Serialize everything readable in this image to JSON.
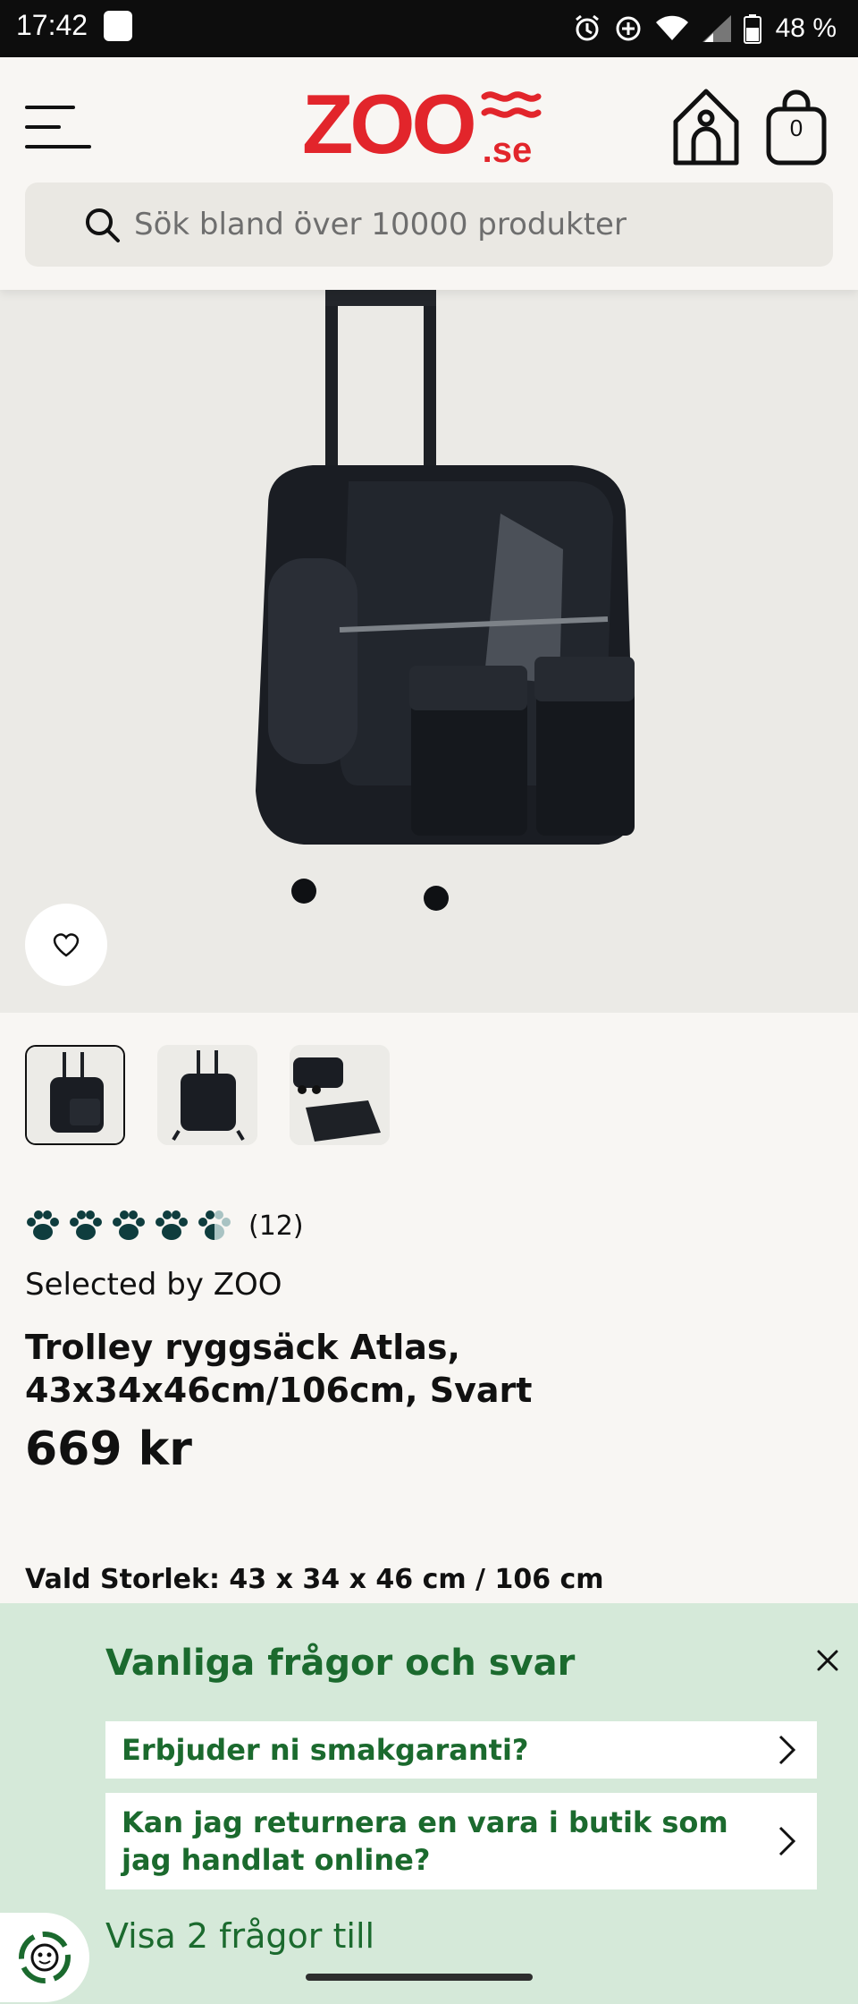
{
  "status_bar": {
    "time": "17:42",
    "battery_percent": "48 %"
  },
  "header": {
    "logo_text": "ZOO",
    "logo_suffix": ".se",
    "cart_count": "0",
    "search_placeholder": "Sök bland över 10000 produkter"
  },
  "product": {
    "rating_count": "(12)",
    "rating_value": 4.5,
    "brand": "Selected by ZOO",
    "title": "Trolley ryggsäck Atlas, 43x34x46cm/106cm, Svart",
    "price": "669 kr",
    "selected_size": "Vald Storlek: 43 x 34 x 46 cm / 106 cm"
  },
  "faq": {
    "title": "Vanliga frågor och svar",
    "questions": [
      "Erbjuder ni smakgaranti?",
      "Kan jag returnera en vara i butik som jag handlat online?"
    ],
    "more_link": "Visa 2 frågor till"
  },
  "colors": {
    "brand_red": "#e2252b",
    "faq_green": "#1b6a2e",
    "faq_bg": "#d5e9d9",
    "paw_dark": "#0f3d3e"
  }
}
